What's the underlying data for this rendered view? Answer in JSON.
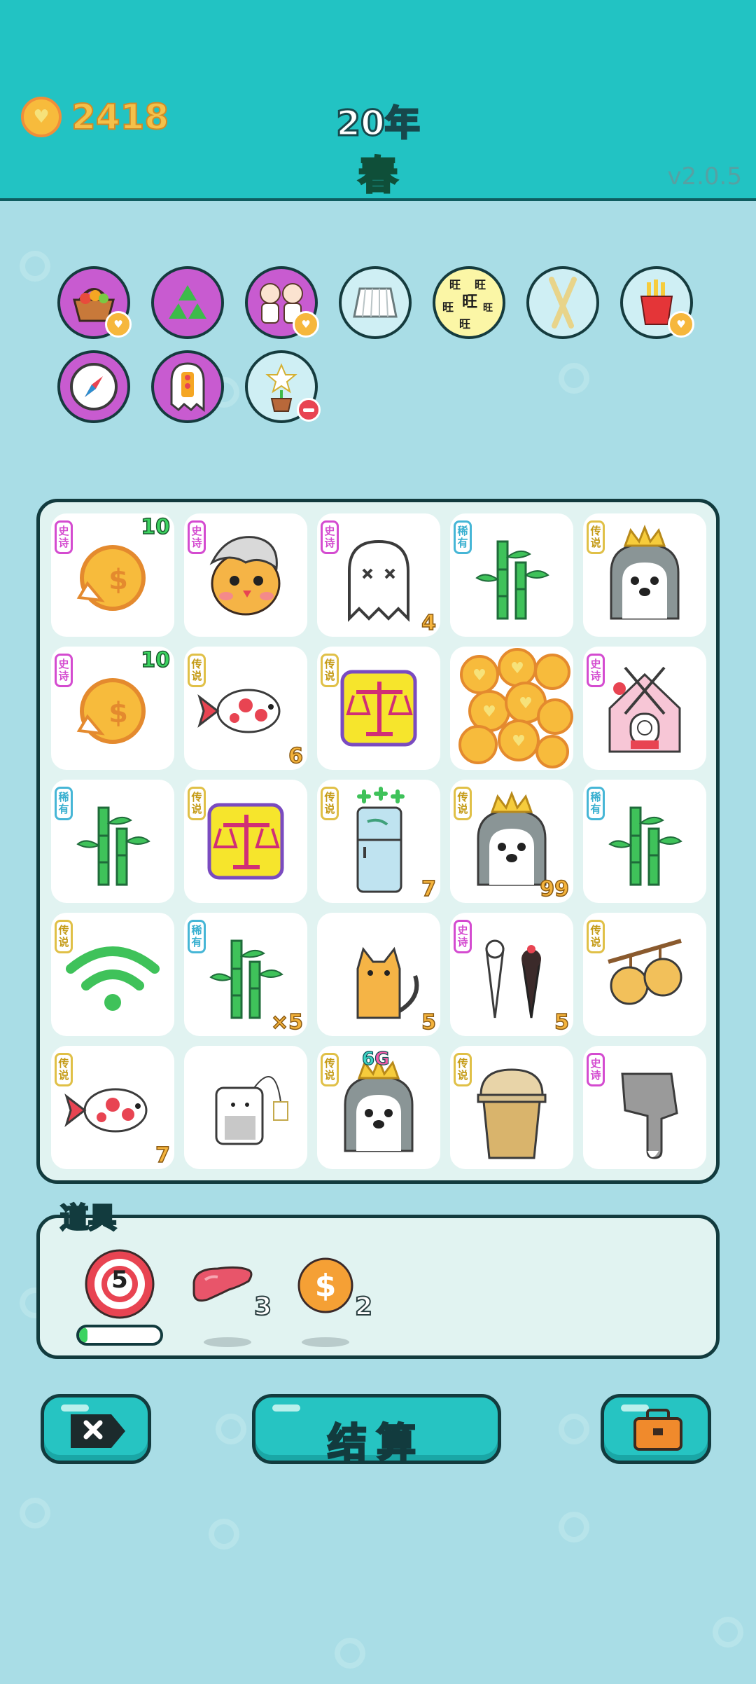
{
  "header": {
    "coins": "2418",
    "year": "20年",
    "season": "春",
    "version": "v2.0.5"
  },
  "buffs": [
    {
      "name": "fruit-basket-icon",
      "bg": "#c85bd0"
    },
    {
      "name": "recycle-icon",
      "bg": "#c85bd0"
    },
    {
      "name": "twin-girls-icon",
      "bg": "#c85bd0"
    },
    {
      "name": "skirt-icon",
      "bg": "#cfeff4"
    },
    {
      "name": "wang-text-icon",
      "bg": "#fbf6a6"
    },
    {
      "name": "chopsticks-icon",
      "bg": "#cfeff4"
    },
    {
      "name": "french-fries-icon",
      "bg": "#cfeff4"
    },
    {
      "name": "compass-icon",
      "bg": "#c85bd0"
    },
    {
      "name": "ghost-traffic-light-icon",
      "bg": "#c85bd0"
    },
    {
      "name": "potted-flower-icon",
      "bg": "#cfeff4"
    }
  ],
  "rarity_labels": {
    "epic": "史诗",
    "legendary": "传说",
    "rare": "稀有"
  },
  "board": [
    {
      "name": "gold-coin-tile",
      "rarity": "史诗",
      "count": "10",
      "count_pos": "top"
    },
    {
      "name": "grey-hair-chick-tile",
      "rarity": "史诗",
      "count": ""
    },
    {
      "name": "ghost-tile",
      "rarity": "史诗",
      "count": "4"
    },
    {
      "name": "bamboo-tile",
      "rarity": "稀有",
      "count": ""
    },
    {
      "name": "king-husky-tile",
      "rarity": "传说",
      "count": ""
    },
    {
      "name": "gold-coin-tile",
      "rarity": "史诗",
      "count": "10",
      "count_pos": "top"
    },
    {
      "name": "koi-fish-tile",
      "rarity": "传说",
      "count": "6"
    },
    {
      "name": "scales-tile",
      "rarity": "传说",
      "count": ""
    },
    {
      "name": "coin-pile-tile",
      "rarity": "",
      "count": ""
    },
    {
      "name": "rabbit-house-tile",
      "rarity": "史诗",
      "count": ""
    },
    {
      "name": "bamboo-tile",
      "rarity": "稀有",
      "count": ""
    },
    {
      "name": "scales-tile",
      "rarity": "传说",
      "count": ""
    },
    {
      "name": "fridge-tile",
      "rarity": "传说",
      "count": "7"
    },
    {
      "name": "king-husky-tile",
      "rarity": "传说",
      "count": "99"
    },
    {
      "name": "bamboo-tile",
      "rarity": "稀有",
      "count": ""
    },
    {
      "name": "wifi-tile",
      "rarity": "传说",
      "count": ""
    },
    {
      "name": "bamboo-tile",
      "rarity": "稀有",
      "count": "×5"
    },
    {
      "name": "cat-tile",
      "rarity": "",
      "count": "5"
    },
    {
      "name": "ice-cream-tile",
      "rarity": "史诗",
      "count": "5"
    },
    {
      "name": "fruit-branch-tile",
      "rarity": "传说",
      "count": ""
    },
    {
      "name": "koi-fish-tile",
      "rarity": "传说",
      "count": "7"
    },
    {
      "name": "tea-bag-tile",
      "rarity": "",
      "count": ""
    },
    {
      "name": "king-husky-tile",
      "rarity": "传说",
      "count": "6G",
      "count_pos": "mid"
    },
    {
      "name": "bubble-tea-tile",
      "rarity": "传说",
      "count": ""
    },
    {
      "name": "pointing-finger-tile",
      "rarity": "史诗",
      "count": ""
    }
  ],
  "items_panel": {
    "title": "道具",
    "dart": {
      "value": "5",
      "progress": 0.1
    },
    "liver": {
      "count": "3"
    },
    "coin": {
      "count": "2"
    }
  },
  "buttons": {
    "settle_label": "结算"
  },
  "colors": {
    "header_bg": "#22c3c3",
    "page_bg": "#a9dde6",
    "button_bg": "#26c4c2"
  }
}
